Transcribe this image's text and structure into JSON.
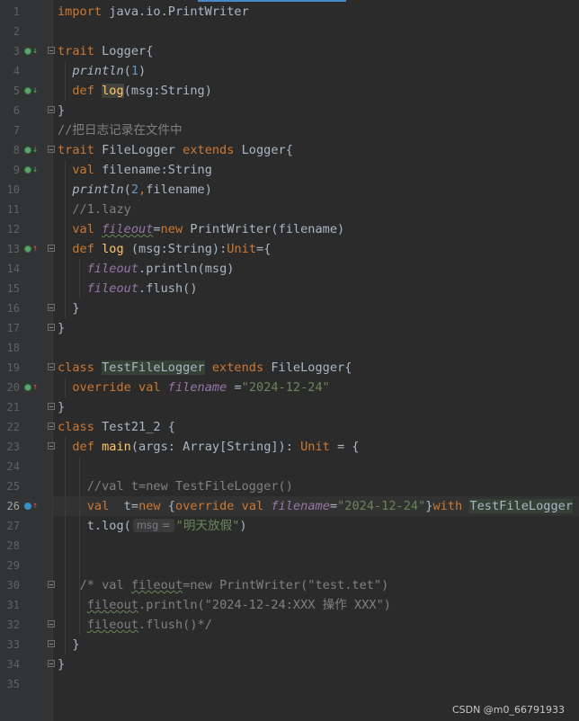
{
  "editor": {
    "lines": [
      {
        "n": "1",
        "tokens": [
          {
            "c": "kw",
            "t": "import"
          },
          {
            "c": "",
            "t": " java.io.PrintWriter"
          }
        ]
      },
      {
        "n": "2",
        "tokens": []
      },
      {
        "n": "3",
        "icon": "implemented-down",
        "fold": true,
        "tokens": [
          {
            "c": "kw",
            "t": "trait"
          },
          {
            "c": "",
            "t": " Logger{"
          }
        ]
      },
      {
        "n": "4",
        "tokens": [
          {
            "c": "",
            "t": "  "
          },
          {
            "c": "it",
            "t": "println"
          },
          {
            "c": "",
            "t": "("
          },
          {
            "c": "num",
            "t": "1"
          },
          {
            "c": "",
            "t": ")"
          }
        ]
      },
      {
        "n": "5",
        "icon": "implemented-down",
        "tokens": [
          {
            "c": "",
            "t": "  "
          },
          {
            "c": "kw",
            "t": "def "
          },
          {
            "c": "fn hl-log",
            "t": "log"
          },
          {
            "c": "",
            "t": "(msg:String)"
          }
        ]
      },
      {
        "n": "6",
        "fold": true,
        "tokens": [
          {
            "c": "",
            "t": "}"
          }
        ]
      },
      {
        "n": "7",
        "tokens": [
          {
            "c": "cmt",
            "t": "//把日志记录在文件中"
          }
        ]
      },
      {
        "n": "8",
        "icon": "implemented-down",
        "fold": true,
        "tokens": [
          {
            "c": "kw",
            "t": "trait"
          },
          {
            "c": "",
            "t": " FileLogger "
          },
          {
            "c": "kw",
            "t": "extends"
          },
          {
            "c": "",
            "t": " Logger{"
          }
        ]
      },
      {
        "n": "9",
        "icon": "implemented-down",
        "tokens": [
          {
            "c": "",
            "t": "  "
          },
          {
            "c": "kw",
            "t": "val"
          },
          {
            "c": "",
            "t": " filename:String"
          }
        ]
      },
      {
        "n": "10",
        "tokens": [
          {
            "c": "",
            "t": "  "
          },
          {
            "c": "it",
            "t": "println"
          },
          {
            "c": "",
            "t": "("
          },
          {
            "c": "num",
            "t": "2"
          },
          {
            "c": "kw",
            "t": ","
          },
          {
            "c": "",
            "t": "filename)"
          }
        ]
      },
      {
        "n": "11",
        "tokens": [
          {
            "c": "",
            "t": "  "
          },
          {
            "c": "cmt",
            "t": "//1.lazy"
          }
        ]
      },
      {
        "n": "12",
        "tokens": [
          {
            "c": "",
            "t": "  "
          },
          {
            "c": "kw",
            "t": "val "
          },
          {
            "c": "fld squig",
            "t": "fileout"
          },
          {
            "c": "",
            "t": "="
          },
          {
            "c": "kw",
            "t": "new"
          },
          {
            "c": "",
            "t": " PrintWriter(filename)"
          }
        ]
      },
      {
        "n": "13",
        "icon": "overrides-up",
        "fold": true,
        "tokens": [
          {
            "c": "",
            "t": "  "
          },
          {
            "c": "kw",
            "t": "def "
          },
          {
            "c": "fn",
            "t": "log"
          },
          {
            "c": "",
            "t": " (msg:String):"
          },
          {
            "c": "kw",
            "t": "Unit"
          },
          {
            "c": "",
            "t": "={"
          }
        ]
      },
      {
        "n": "14",
        "tokens": [
          {
            "c": "",
            "t": "    "
          },
          {
            "c": "fld",
            "t": "fileout"
          },
          {
            "c": "",
            "t": ".println(msg)"
          }
        ]
      },
      {
        "n": "15",
        "tokens": [
          {
            "c": "",
            "t": "    "
          },
          {
            "c": "fld",
            "t": "fileout"
          },
          {
            "c": "",
            "t": ".flush()"
          }
        ]
      },
      {
        "n": "16",
        "fold": true,
        "tokens": [
          {
            "c": "",
            "t": "  }"
          }
        ]
      },
      {
        "n": "17",
        "fold": true,
        "tokens": [
          {
            "c": "",
            "t": "}"
          }
        ]
      },
      {
        "n": "18",
        "tokens": []
      },
      {
        "n": "19",
        "fold": true,
        "tokens": [
          {
            "c": "kw",
            "t": "class"
          },
          {
            "c": "",
            "t": " "
          },
          {
            "c": "hl-def",
            "t": "TestFileLogger"
          },
          {
            "c": "",
            "t": " "
          },
          {
            "c": "kw",
            "t": "extends"
          },
          {
            "c": "",
            "t": " FileLogger{"
          }
        ]
      },
      {
        "n": "20",
        "icon": "overrides-up",
        "tokens": [
          {
            "c": "",
            "t": "  "
          },
          {
            "c": "kw",
            "t": "override val "
          },
          {
            "c": "fld",
            "t": "filename"
          },
          {
            "c": "",
            "t": " ="
          },
          {
            "c": "str",
            "t": "\"2024-12-24\""
          }
        ]
      },
      {
        "n": "21",
        "fold": true,
        "tokens": [
          {
            "c": "",
            "t": "}"
          }
        ]
      },
      {
        "n": "22",
        "fold": true,
        "tokens": [
          {
            "c": "kw",
            "t": "class"
          },
          {
            "c": "",
            "t": " Test21_2 {"
          }
        ]
      },
      {
        "n": "23",
        "fold": true,
        "tokens": [
          {
            "c": "",
            "t": "  "
          },
          {
            "c": "kw",
            "t": "def "
          },
          {
            "c": "fn",
            "t": "main"
          },
          {
            "c": "",
            "t": "(args: Array[String]): "
          },
          {
            "c": "kw",
            "t": "Unit"
          },
          {
            "c": "",
            "t": " = {"
          }
        ]
      },
      {
        "n": "24",
        "tokens": []
      },
      {
        "n": "25",
        "tokens": [
          {
            "c": "",
            "t": "    "
          },
          {
            "c": "cmt",
            "t": "//val t=new TestFileLogger()"
          }
        ]
      },
      {
        "n": "26",
        "icon": "overrides-up-blue",
        "current": true,
        "tokens": [
          {
            "c": "",
            "t": "    "
          },
          {
            "c": "kw",
            "t": "val"
          },
          {
            "c": "",
            "t": "  t="
          },
          {
            "c": "kw",
            "t": "new"
          },
          {
            "c": "",
            "t": " {"
          },
          {
            "c": "kw",
            "t": "override val "
          },
          {
            "c": "fld",
            "t": "filename"
          },
          {
            "c": "",
            "t": "="
          },
          {
            "c": "str",
            "t": "\"2024-12-24\""
          },
          {
            "c": "",
            "t": "}"
          },
          {
            "c": "kw",
            "t": "with"
          },
          {
            "c": "",
            "t": " "
          },
          {
            "c": "hl-def",
            "t": "TestFileLogger"
          }
        ]
      },
      {
        "n": "27",
        "tokens": [
          {
            "c": "",
            "t": "    t.log("
          },
          {
            "c": "hint",
            "t": "msg ="
          },
          {
            "c": "str",
            "t": "\"明天放假\""
          },
          {
            "c": "",
            "t": ")"
          }
        ]
      },
      {
        "n": "28",
        "tokens": []
      },
      {
        "n": "29",
        "tokens": []
      },
      {
        "n": "30",
        "fold": true,
        "tokens": [
          {
            "c": "",
            "t": "   "
          },
          {
            "c": "cmt",
            "t": "/* val "
          },
          {
            "c": "cmt squig",
            "t": "fileout"
          },
          {
            "c": "cmt",
            "t": "=new PrintWriter(\"test.tet\")"
          }
        ]
      },
      {
        "n": "31",
        "tokens": [
          {
            "c": "",
            "t": "    "
          },
          {
            "c": "cmt squig",
            "t": "fileout"
          },
          {
            "c": "cmt",
            "t": ".println(\"2024-12-24:XXX 操作 XXX\")"
          }
        ]
      },
      {
        "n": "32",
        "fold": true,
        "tokens": [
          {
            "c": "",
            "t": "    "
          },
          {
            "c": "cmt squig",
            "t": "fileout"
          },
          {
            "c": "cmt",
            "t": ".flush()*/"
          }
        ]
      },
      {
        "n": "33",
        "fold": true,
        "tokens": [
          {
            "c": "",
            "t": "  }"
          }
        ]
      },
      {
        "n": "34",
        "fold": true,
        "tokens": [
          {
            "c": "",
            "t": "}"
          }
        ]
      },
      {
        "n": "35",
        "tokens": []
      }
    ]
  },
  "watermark": "CSDN @m0_66791933"
}
